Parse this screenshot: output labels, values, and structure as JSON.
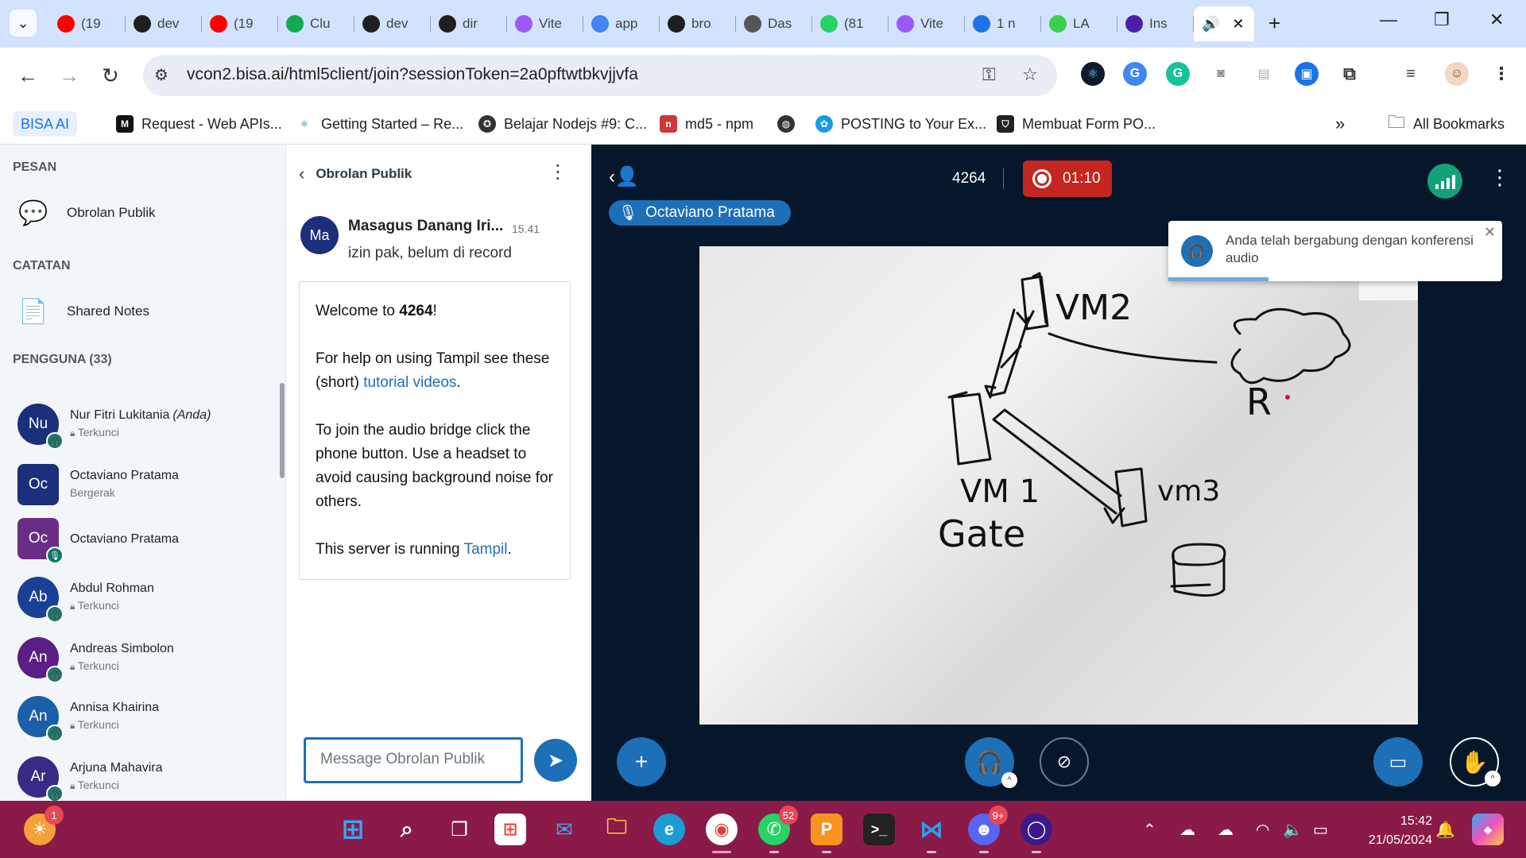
{
  "browser": {
    "tabs": [
      {
        "title": "(19",
        "icon": "youtube-icon",
        "color": "#ff0000"
      },
      {
        "title": "dev",
        "icon": "github-icon",
        "color": "#1f1f1f"
      },
      {
        "title": "(19",
        "icon": "youtube-icon",
        "color": "#ff0000"
      },
      {
        "title": "Clu",
        "icon": "mongodb-icon",
        "color": "#13aa52"
      },
      {
        "title": "dev",
        "icon": "github-icon",
        "color": "#1f1f1f"
      },
      {
        "title": "dir",
        "icon": "github-icon",
        "color": "#1f1f1f"
      },
      {
        "title": "Vite",
        "icon": "vite-icon",
        "color": "#9b59f6"
      },
      {
        "title": "app",
        "icon": "google-icon",
        "color": "#4285f4"
      },
      {
        "title": "bro",
        "icon": "github-icon",
        "color": "#1f1f1f"
      },
      {
        "title": "Das",
        "icon": "page-icon",
        "color": "#555555"
      },
      {
        "title": "(81",
        "icon": "whatsapp-icon",
        "color": "#25d366"
      },
      {
        "title": "Vite",
        "icon": "vite-icon",
        "color": "#9b59f6"
      },
      {
        "title": "1 n",
        "icon": "badge-icon",
        "color": "#1a73e8"
      },
      {
        "title": "LA",
        "icon": "sparkle-icon",
        "color": "#3ccf4e"
      },
      {
        "title": "Ins",
        "icon": "circle-icon",
        "color": "#4b1fa8"
      }
    ],
    "url": "vcon2.bisa.ai/html5client/join?sessionToken=2a0pftwtbkvjjvfa",
    "bookmarks": [
      {
        "label": "BISA AI"
      },
      {
        "label": "Request - Web APIs..."
      },
      {
        "label": "Getting Started – Re..."
      },
      {
        "label": "Belajar Nodejs #9: C..."
      },
      {
        "label": "md5 - npm"
      },
      {
        "label": ""
      },
      {
        "label": "POSTING to Your Ex..."
      },
      {
        "label": "Membuat Form PO..."
      }
    ],
    "all_bookmarks": "All Bookmarks",
    "more_bookmarks": "»"
  },
  "sidebar": {
    "messages_header": "PESAN",
    "public_chat": "Obrolan Publik",
    "notes_header": "CATATAN",
    "shared_notes": "Shared Notes",
    "users_header": "PENGGUNA (33)",
    "users": [
      {
        "initials": "Nu",
        "name": "Nur Fitri Lukitania",
        "you": "(Anda)",
        "status": "Terkunci",
        "color": "#1b2f7a"
      },
      {
        "initials": "Oc",
        "name": "Octaviano Pratama",
        "you": "",
        "status": "Bergerak",
        "color": "#1b2f7a"
      },
      {
        "initials": "Oc",
        "name": "Octaviano Pratama",
        "you": "",
        "status": "",
        "color": "#6a2d86"
      },
      {
        "initials": "Ab",
        "name": "Abdul Rohman",
        "you": "",
        "status": "Terkunci",
        "color": "#1a3f96"
      },
      {
        "initials": "An",
        "name": "Andreas Simbolon",
        "you": "",
        "status": "Terkunci",
        "color": "#5b1e86"
      },
      {
        "initials": "An",
        "name": "Annisa Khairina",
        "you": "",
        "status": "Terkunci",
        "color": "#1a5fa8"
      },
      {
        "initials": "Ar",
        "name": "Arjuna Mahavira",
        "you": "",
        "status": "Terkunci",
        "color": "#3a2a86"
      }
    ]
  },
  "chat": {
    "title": "Obrolan Publik",
    "message": {
      "initials": "Ma",
      "author": "Masagus Danang Iri...",
      "time": "15.41",
      "text": "izin pak, belum di record"
    },
    "welcome": {
      "line1_pre": "Welcome to ",
      "line1_bold": "4264",
      "line1_post": "!",
      "line2_pre": "For help on using Tampil see these (short) ",
      "line2_link": "tutorial videos",
      "line2_post": ".",
      "line3": "To join the audio bridge click the phone button. Use a headset to avoid causing background noise for others.",
      "line4_pre": "This server is running ",
      "line4_link": "Tampil",
      "line4_post": "."
    },
    "input_placeholder": "Message Obrolan Publik"
  },
  "stage": {
    "talker": "Octaviano Pratama",
    "meeting_name": "4264",
    "rec_time": "01:10",
    "toast": "Anda telah bergabung dengan konferensi audio",
    "toast_progress": 0.3,
    "whiteboard_labels": [
      "VM2",
      "VM 1",
      "Gate",
      "vm3",
      "R"
    ]
  },
  "taskbar": {
    "weather_badge": "1",
    "whatsapp_badge": "52",
    "discord_badge": "9+",
    "time": "15:42",
    "date": "21/05/2024"
  }
}
